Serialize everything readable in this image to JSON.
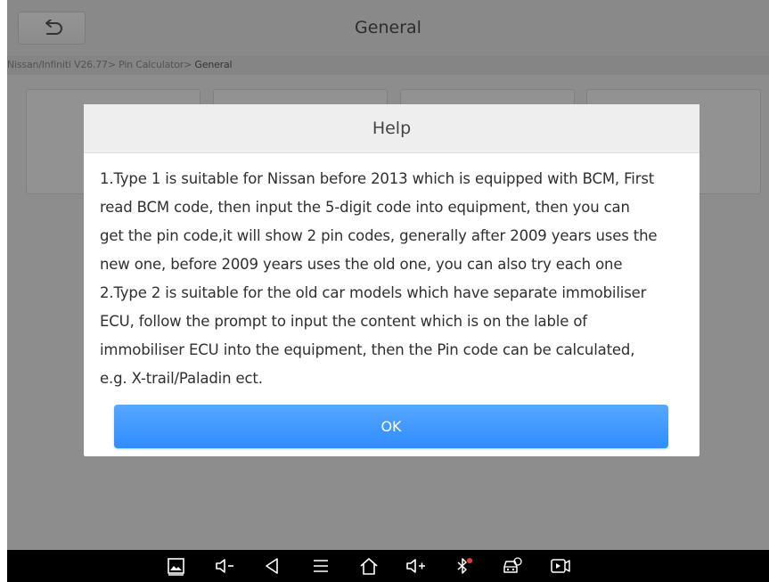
{
  "header": {
    "title": "General"
  },
  "breadcrumb": {
    "path": "Nissan/Infiniti V26.77> Pin Calculator> ",
    "current": "General"
  },
  "dialog": {
    "title": "Help",
    "lines": [
      "1.Type 1 is suitable for Nissan before 2013 which is equipped with BCM, First",
      "read BCM code, then input the 5-digit code into equipment, then you can",
      "get the pin code,it will show 2 pin codes, generally after 2009 years uses the",
      "new one, before 2009 years uses the old one, you can also try each one",
      "2.Type 2 is suitable for the old car models which have separate immobiliser",
      "ECU, follow the prompt to input the content which is on the lable of",
      "immobiliser ECU into the equipment, then the Pin code can be calculated,",
      "e.g. X-trail/Paladin ect."
    ],
    "ok_label": "OK"
  },
  "navbar": {
    "vol_down": "◁-",
    "vol_up": "◁+",
    "icons": [
      "screenshot-icon",
      "volume-down-icon",
      "back-icon",
      "menu-icon",
      "home-icon",
      "volume-up-icon",
      "bluetooth-icon",
      "vci-car-icon",
      "screen-record-icon"
    ]
  },
  "colors": {
    "accent": "#3b95ff",
    "nav_bg": "#000000",
    "bt_dot": "#e53935"
  }
}
